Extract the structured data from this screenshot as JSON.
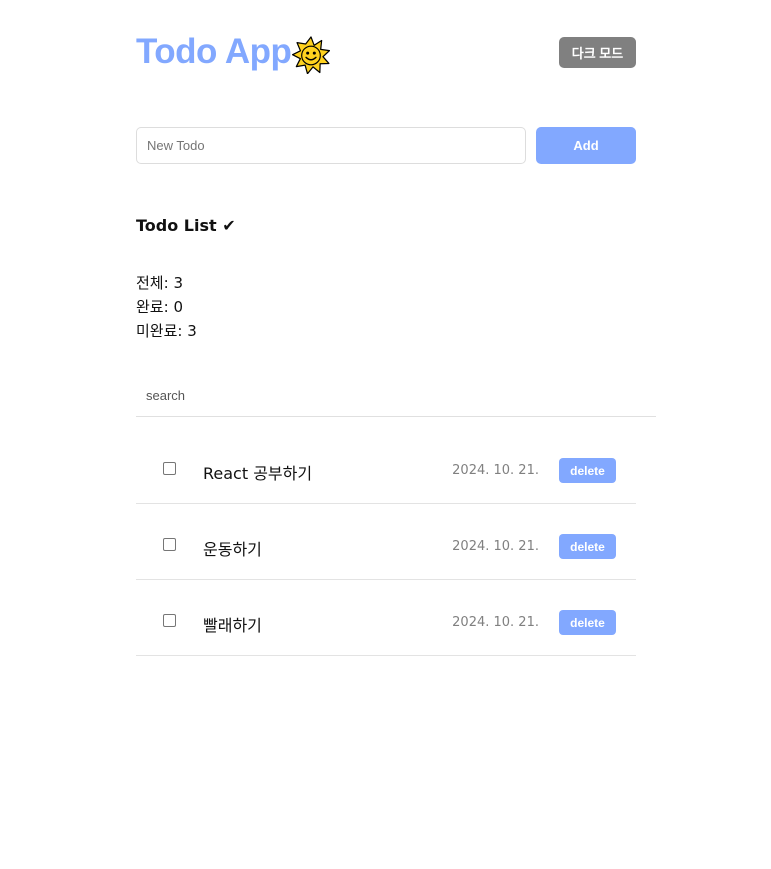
{
  "header": {
    "title": "Todo App",
    "icon": "smiling-sun-icon",
    "dark_mode_label": "다크 모드"
  },
  "new_todo": {
    "placeholder": "New Todo",
    "value": "",
    "add_label": "Add"
  },
  "list": {
    "title": "Todo List ✔",
    "stats": {
      "total_label": "전체:",
      "total": "3",
      "done_label": "완료:",
      "done": "0",
      "undone_label": "미완료:",
      "undone": "3"
    },
    "search_placeholder": "search",
    "items": [
      {
        "text": "React 공부하기",
        "date": "2024. 10. 21.",
        "done": false,
        "delete_label": "delete"
      },
      {
        "text": "운동하기",
        "date": "2024. 10. 21.",
        "done": false,
        "delete_label": "delete"
      },
      {
        "text": "빨래하기",
        "date": "2024. 10. 21.",
        "done": false,
        "delete_label": "delete"
      }
    ]
  },
  "colors": {
    "accent": "#82a8ff",
    "dark_button": "#808080",
    "sun_fill": "#ffd21f"
  }
}
